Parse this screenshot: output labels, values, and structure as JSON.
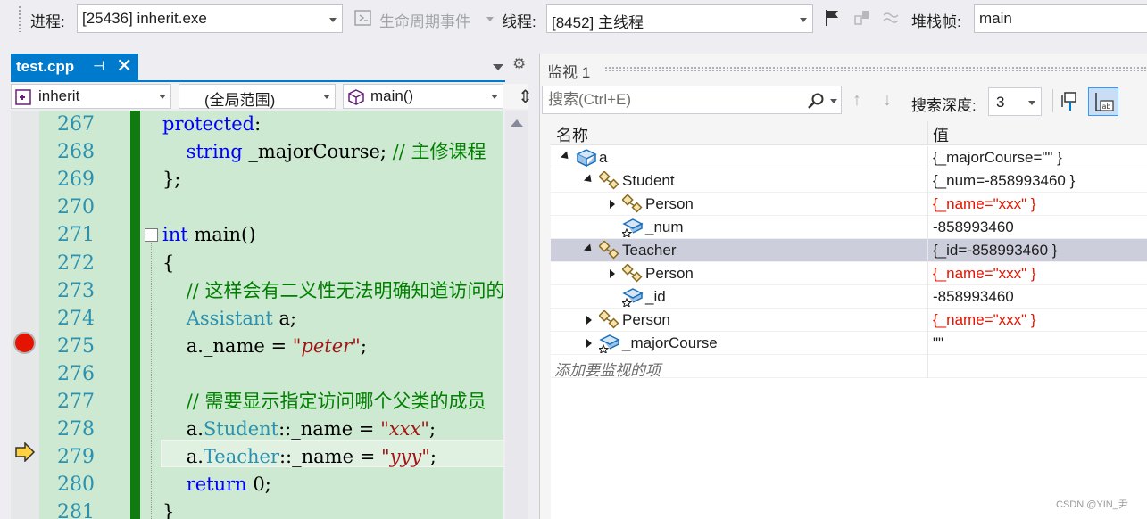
{
  "toolbar": {
    "process_label": "进程:",
    "process_value": "[25436] inherit.exe",
    "lifecycle_label": "生命周期事件",
    "thread_label": "线程:",
    "thread_value": "[8452] 主线程",
    "stackframe_label": "堆栈帧:",
    "stackframe_value": "main"
  },
  "editor": {
    "tab_name": "test.cpp",
    "pin_glyph": "⊣",
    "close_glyph": "✕",
    "nav_project": "inherit",
    "nav_scope": "(全局范围)",
    "nav_function": "main()",
    "lines": [
      {
        "num": "267",
        "parts": [
          {
            "c": "kw",
            "t": "protected"
          },
          {
            "c": "pl",
            "t": ":"
          }
        ]
      },
      {
        "num": "268",
        "parts": [
          {
            "c": "pl",
            "t": "    "
          },
          {
            "c": "kw",
            "t": "string"
          },
          {
            "c": "pl",
            "t": " _majorCourse; "
          },
          {
            "c": "cm",
            "t": "// 主修课程"
          }
        ]
      },
      {
        "num": "269",
        "parts": [
          {
            "c": "pl",
            "t": "};"
          }
        ]
      },
      {
        "num": "270",
        "parts": []
      },
      {
        "num": "271",
        "parts": [
          {
            "c": "kw",
            "t": "int"
          },
          {
            "c": "pl",
            "t": " main()"
          }
        ]
      },
      {
        "num": "272",
        "parts": [
          {
            "c": "pl",
            "t": "{"
          }
        ]
      },
      {
        "num": "273",
        "parts": [
          {
            "c": "pl",
            "t": "    "
          },
          {
            "c": "cm",
            "t": "// 这样会有二义性无法明确知道访问的是哪一个"
          }
        ]
      },
      {
        "num": "274",
        "parts": [
          {
            "c": "pl",
            "t": "    "
          },
          {
            "c": "ty",
            "t": "Assistant"
          },
          {
            "c": "pl",
            "t": " a;"
          }
        ]
      },
      {
        "num": "275",
        "parts": [
          {
            "c": "pl",
            "t": "    a._name = "
          },
          {
            "c": "st",
            "t": "\"peter\""
          },
          {
            "c": "pl",
            "t": ";"
          }
        ]
      },
      {
        "num": "276",
        "parts": []
      },
      {
        "num": "277",
        "parts": [
          {
            "c": "pl",
            "t": "    "
          },
          {
            "c": "cm",
            "t": "// 需要显示指定访问哪个父类的成员"
          }
        ]
      },
      {
        "num": "278",
        "parts": [
          {
            "c": "pl",
            "t": "    a."
          },
          {
            "c": "ty",
            "t": "Student"
          },
          {
            "c": "pl",
            "t": "::_name = "
          },
          {
            "c": "st",
            "t": "\"xxx\""
          },
          {
            "c": "pl",
            "t": ";"
          }
        ]
      },
      {
        "num": "279",
        "parts": [
          {
            "c": "pl",
            "t": "    a."
          },
          {
            "c": "ty",
            "t": "Teacher"
          },
          {
            "c": "pl",
            "t": "::_name = "
          },
          {
            "c": "st",
            "t": "\"yyy\""
          },
          {
            "c": "pl",
            "t": ";"
          }
        ]
      },
      {
        "num": "280",
        "parts": [
          {
            "c": "pl",
            "t": "    "
          },
          {
            "c": "kw",
            "t": "return"
          },
          {
            "c": "pl",
            "t": " 0;"
          }
        ]
      },
      {
        "num": "281",
        "parts": [
          {
            "c": "pl",
            "t": "}"
          }
        ]
      }
    ]
  },
  "watch": {
    "title": "监视 1",
    "search_placeholder": "搜索(Ctrl+E)",
    "depth_label": "搜索深度:",
    "depth_value": "3",
    "col_name": "名称",
    "col_value": "值",
    "add_watch": "添加要监视的项",
    "rows": [
      {
        "name": "a",
        "value": "{_majorCourse=\"\" }",
        "changed": false
      },
      {
        "name": "Student",
        "value": "{_num=-858993460 }",
        "changed": false
      },
      {
        "name": "Person",
        "value": "{_name=\"xxx\" }",
        "changed": true
      },
      {
        "name": "_num",
        "value": "-858993460",
        "changed": false
      },
      {
        "name": "Teacher",
        "value": "{_id=-858993460 }",
        "changed": false
      },
      {
        "name": "Person",
        "value": "{_name=\"xxx\" }",
        "changed": true
      },
      {
        "name": "_id",
        "value": "-858993460",
        "changed": false
      },
      {
        "name": "Person",
        "value": "{_name=\"xxx\" }",
        "changed": true
      },
      {
        "name": "_majorCourse",
        "value": "\"\"",
        "changed": false
      }
    ]
  },
  "watermark": "CSDN @YIN_尹",
  "colors": {
    "accent": "#007acc",
    "breakpoint": "#e51400",
    "changed_value": "#e51400",
    "change_bar": "#107c10",
    "selection": "#cccedb"
  }
}
